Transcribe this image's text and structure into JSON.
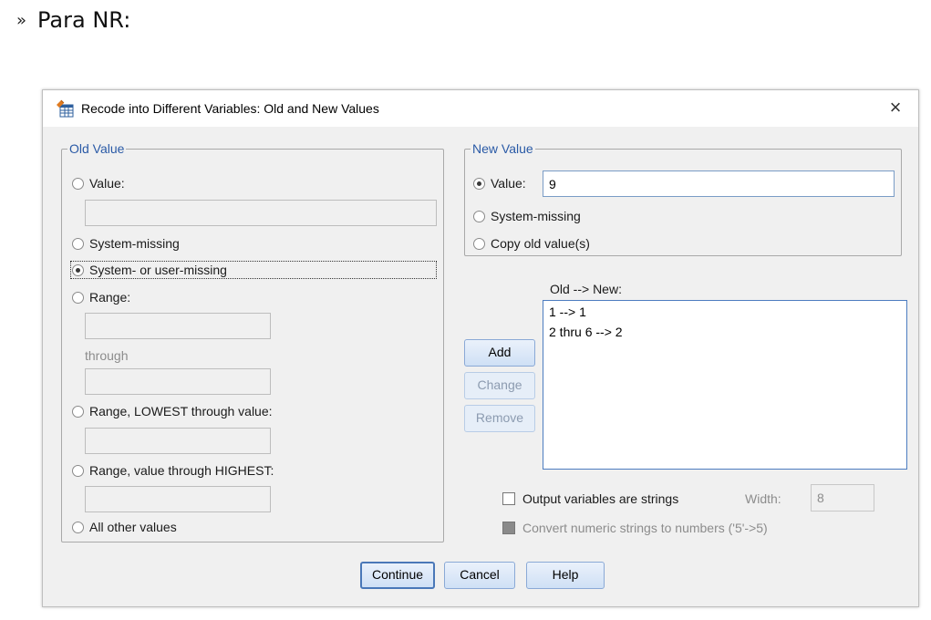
{
  "slide": {
    "bullet": "»",
    "heading": "Para NR:"
  },
  "dialog": {
    "title": "Recode into Different Variables: Old and New Values",
    "close_glyph": "×"
  },
  "old_value": {
    "legend": "Old Value",
    "value_label": "Value:",
    "system_missing_label": "System-missing",
    "sys_or_user_missing_label": "System- or user-missing",
    "range_label": "Range:",
    "through_label": "through",
    "range_lowest_label": "Range, LOWEST through value:",
    "range_highest_label": "Range, value through HIGHEST:",
    "all_other_label": "All other values",
    "selected": "System- or user-missing"
  },
  "new_value": {
    "legend": "New Value",
    "value_label": "Value:",
    "value_input": "9",
    "system_missing_label": "System-missing",
    "copy_old_label": "Copy old value(s)",
    "selected": "Value"
  },
  "recode_list": {
    "header": "Old --> New:",
    "items": [
      "1 --> 1",
      "2 thru 6 --> 2"
    ]
  },
  "buttons": {
    "add": "Add",
    "change": "Change",
    "remove": "Remove",
    "continue": "Continue",
    "cancel": "Cancel",
    "help": "Help"
  },
  "options": {
    "output_strings_label": "Output variables are strings",
    "width_label": "Width:",
    "width_value": "8",
    "convert_label": "Convert numeric strings to numbers ('5'->5)"
  },
  "icons": {
    "app": "spss-table-icon",
    "close": "close-icon"
  },
  "colors": {
    "legend_text": "#2a5aa6",
    "list_border": "#4d7cc0",
    "button_fill": "#cfe0f5"
  }
}
